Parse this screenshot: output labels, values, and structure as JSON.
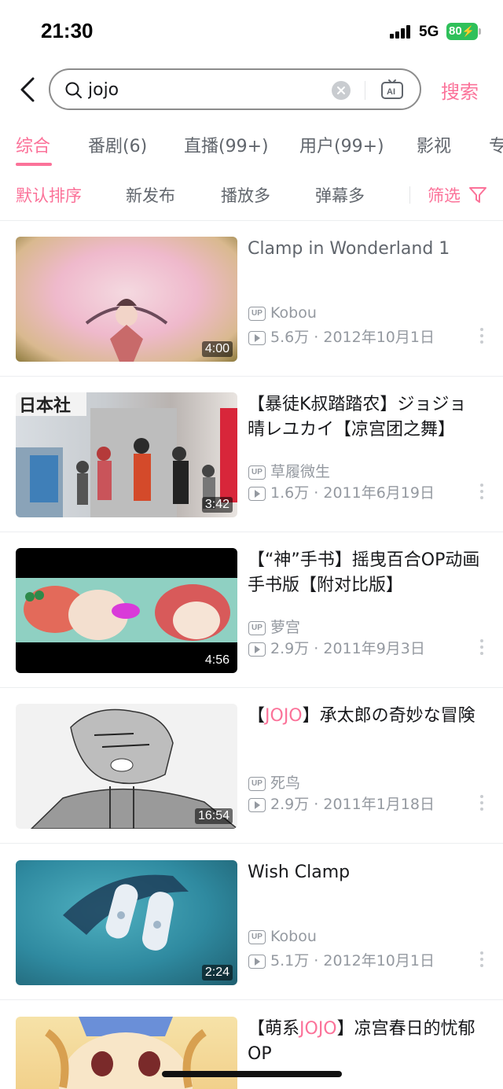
{
  "status_bar": {
    "time": "21:30",
    "network": "5G",
    "battery": "80"
  },
  "search": {
    "query": "jojo",
    "submit_label": "搜索"
  },
  "tabs": [
    {
      "label": "综合",
      "active": true
    },
    {
      "label": "番剧(6)"
    },
    {
      "label": "直播(99+)"
    },
    {
      "label": "用户(99+)"
    },
    {
      "label": "影视"
    },
    {
      "label": "专"
    }
  ],
  "sort": {
    "options": [
      "默认排序",
      "新发布",
      "播放多",
      "弹幕多"
    ],
    "filter_label": "筛选"
  },
  "videos": [
    {
      "title": "Clamp in Wonderland 1",
      "author": "Kobou",
      "views": "5.6万",
      "date": "2012年10月1日",
      "duration": "4:00"
    },
    {
      "title": "【暴徒K叔踏踏农】ジョジョ晴レユカイ【凉宫团之舞】",
      "author": "草履微生",
      "views": "1.6万",
      "date": "2011年6月19日",
      "duration": "3:42"
    },
    {
      "title": "【“神”手书】摇曳百合OP动画手书版【附对比版】",
      "author": "萝宫",
      "views": "2.9万",
      "date": "2011年9月3日",
      "duration": "4:56"
    },
    {
      "title_pre": "【",
      "title_hl": "JOJO",
      "title_post": "】承太郎の奇妙な冒険",
      "author": "死鸟",
      "views": "2.9万",
      "date": "2011年1月18日",
      "duration": "16:54"
    },
    {
      "title": "Wish Clamp",
      "author": "Kobou",
      "views": "5.1万",
      "date": "2012年10月1日",
      "duration": "2:24"
    },
    {
      "title_pre": "【萌系",
      "title_hl": "JOJO",
      "title_post": "】凉宫春日的忧郁OP"
    }
  ],
  "labels": {
    "up_badge": "UP",
    "dot_sep": "·"
  },
  "colors": {
    "accent": "#fb7299",
    "text_gray": "#9499a0",
    "battery_green": "#2fc05a"
  }
}
